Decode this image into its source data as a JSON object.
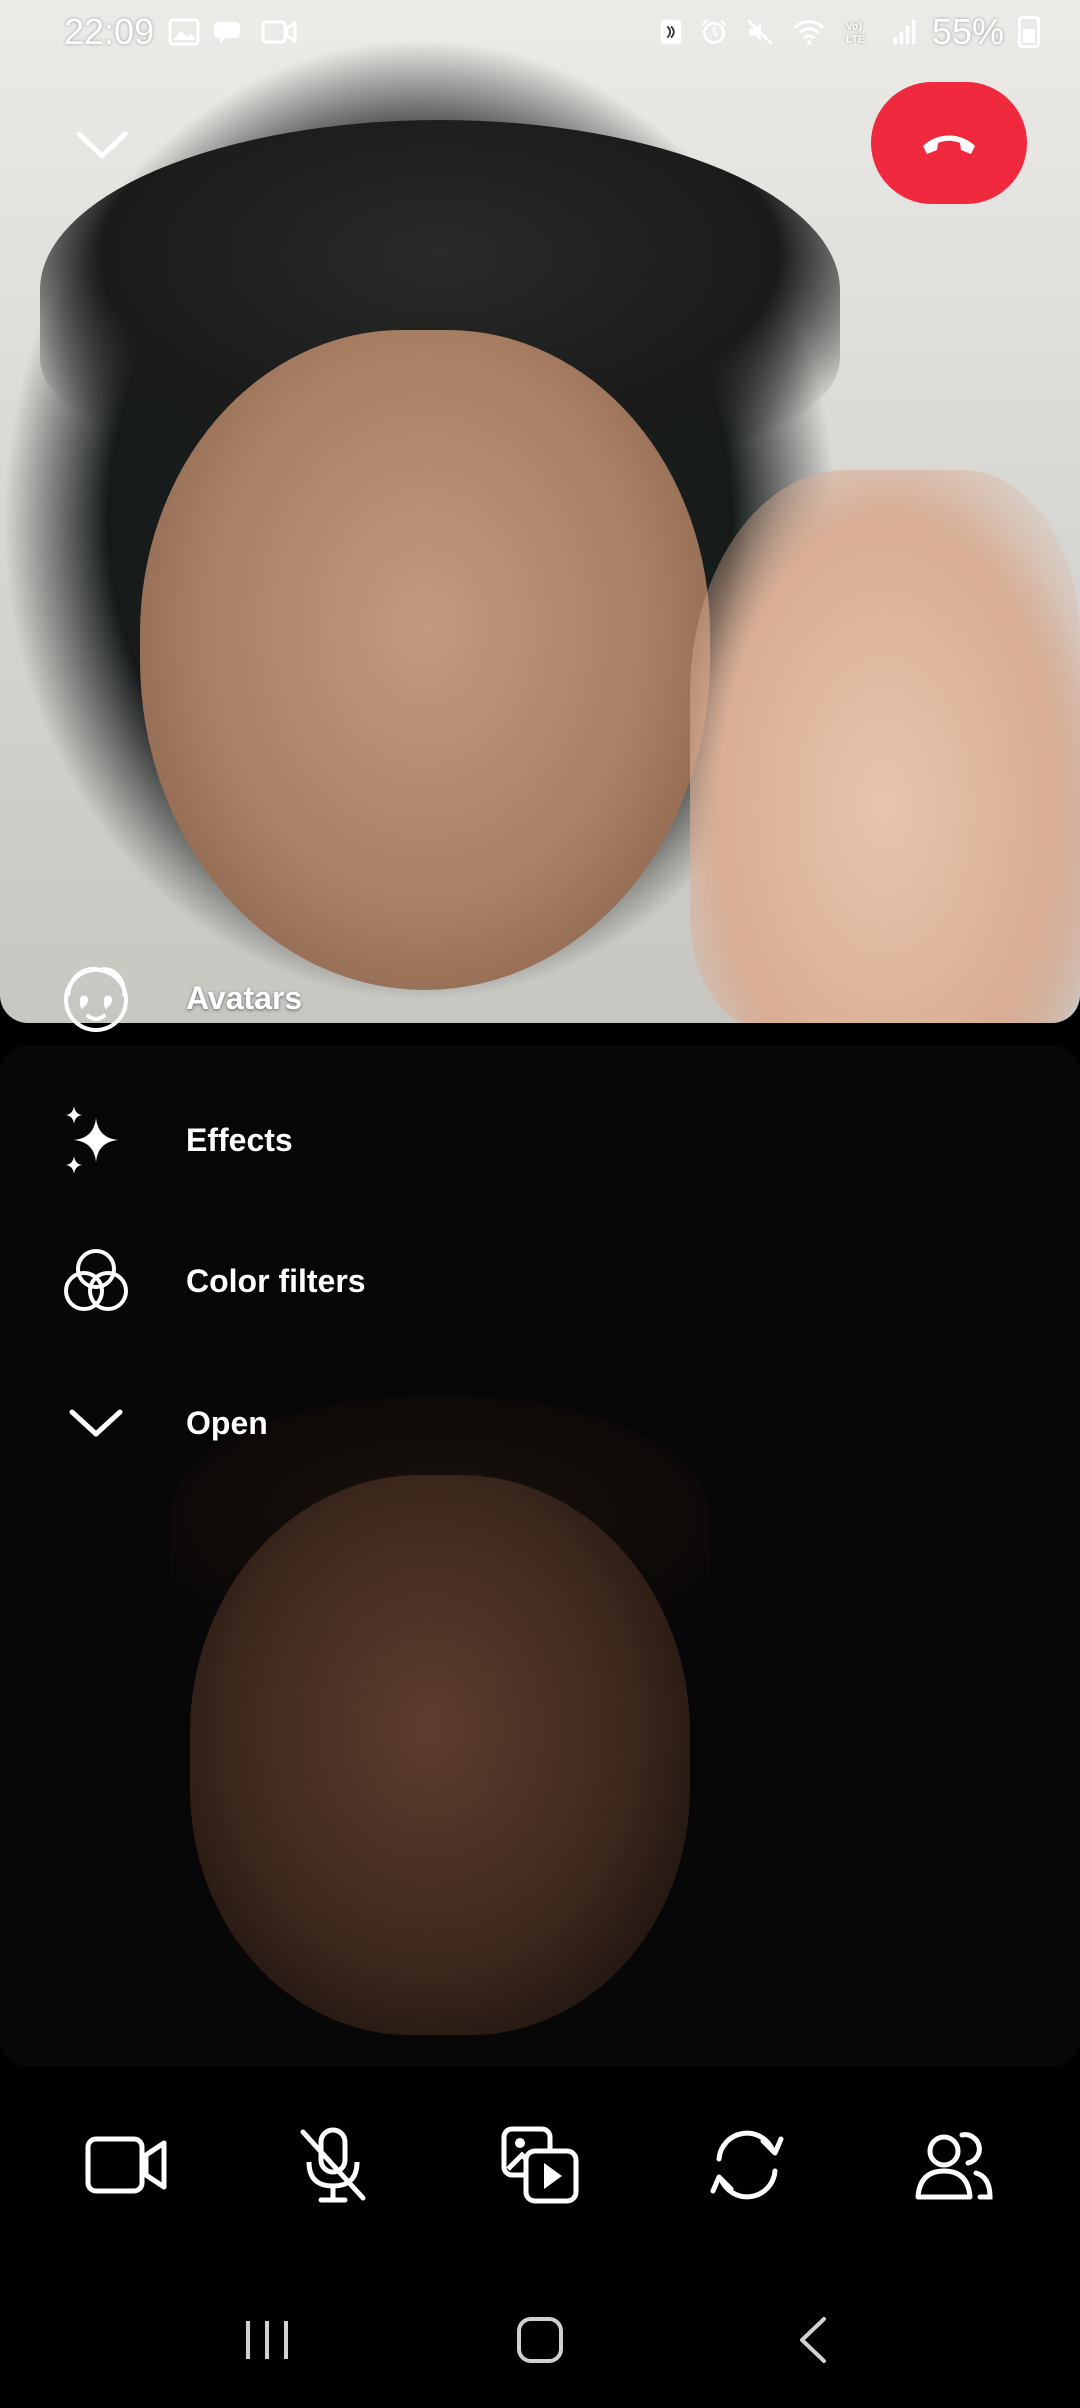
{
  "status_bar": {
    "time": "22:09",
    "battery": "55%",
    "left_icons": [
      "gallery-icon",
      "chat-bubble-icon",
      "video-icon"
    ],
    "right_icons": [
      "nfc-icon",
      "alarm-icon",
      "mute-icon",
      "wifi-icon",
      "volte-icon",
      "signal-icon",
      "battery-icon"
    ]
  },
  "top_controls": {
    "collapse_icon": "chevron-down-icon",
    "end_call_color": "#f0293e",
    "end_call_icon": "phone-hangup-icon"
  },
  "effects_menu": {
    "items": [
      {
        "label": "Avatars",
        "icon": "avatar-icon"
      },
      {
        "label": "Effects",
        "icon": "sparkles-icon"
      },
      {
        "label": "Color filters",
        "icon": "color-filters-icon"
      },
      {
        "label": "Open",
        "icon": "chevron-down-icon"
      }
    ]
  },
  "call_controls": [
    {
      "name": "camera",
      "icon": "video-camera-icon"
    },
    {
      "name": "microphone",
      "icon": "mic-muted-icon"
    },
    {
      "name": "share-media",
      "icon": "media-share-icon"
    },
    {
      "name": "flip-camera",
      "icon": "flip-camera-icon"
    },
    {
      "name": "participants",
      "icon": "add-people-icon"
    }
  ],
  "nav_bar": {
    "items": [
      "recents-icon",
      "home-icon",
      "back-icon"
    ]
  }
}
